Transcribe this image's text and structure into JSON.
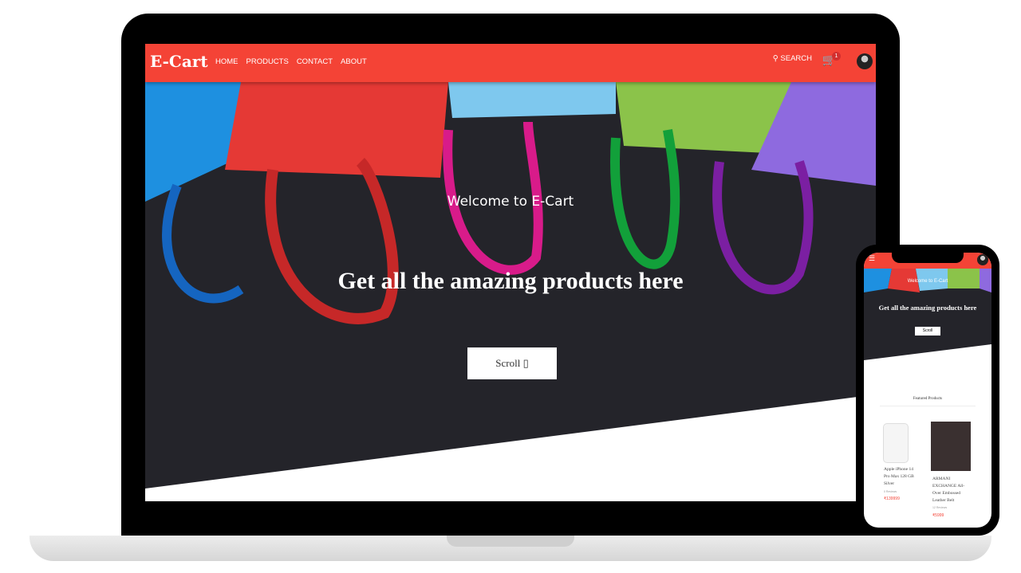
{
  "site": {
    "logo": "E-Cart",
    "nav": [
      "HOME",
      "PRODUCTS",
      "CONTACT",
      "ABOUT"
    ],
    "search_label": "SEARCH",
    "cart_count": "1",
    "brand_color": "#f44336"
  },
  "hero": {
    "welcome": "Welcome to E-Cart",
    "tagline": "Get all the amazing products here",
    "scroll_label": "Scroll"
  },
  "mobile": {
    "welcome": "Welcome to E-Cart",
    "tagline": "Get all the amazing products here",
    "scroll_label": "Scroll",
    "section_title": "Featured Products",
    "products": [
      {
        "name": "Apple iPhone 14 Pro Max 128 GB Silver",
        "reviews": "0 Reviews",
        "price": "₹139999"
      },
      {
        "name": "ARMANI EXCHANGE All-Over Embossed Leather Belt",
        "reviews": "12 Reviews",
        "price": "₹5999"
      }
    ]
  }
}
